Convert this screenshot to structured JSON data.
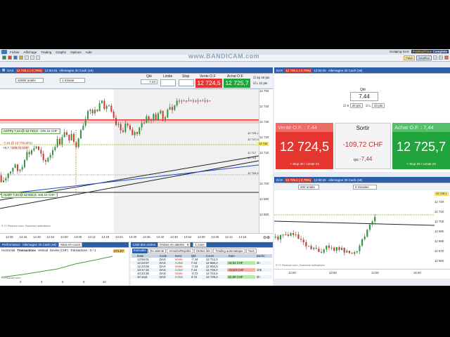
{
  "menu": {
    "items": [
      "Fichier",
      "Affichage",
      "Trading",
      "Graphs",
      "Options",
      "Aide"
    ]
  },
  "topright": {
    "platform_prefix": "Scalping DAX",
    "brand": "ProRealTime",
    "brand_suffix": "Complete",
    "paste": "Patch",
    "account": "DealRoo"
  },
  "watermark": "www.BANDICAM.com",
  "chart1": {
    "title_prefix": "DAX",
    "price": "12 725,1 (-2,79%)",
    "time": "12:50:45",
    "instrument": "Allemagne 30 Cash (1€)",
    "units_select": "10000 unités",
    "tf_select": "1 minute",
    "qty_label": "Qté",
    "qty_value": "7.44",
    "limit_label": "Limite",
    "stop_label": "Stop",
    "sell_label": "Vente O.F.",
    "buy_label": "Achat O.F.",
    "sell_price": "12 724,5",
    "buy_price": "12 725,7",
    "sp_label": "Sp",
    "sp_value": "20 pts",
    "l_label": "L",
    "l_value": "21 pts",
    "tag_stp": "ASTPy 7,44 @ 12 732,0",
    "tag_stp_val": "-109,16 CHF",
    "tag_pos": "-7,44 @ 12 732,8(%)",
    "tag_pos_val": "-109,72 CHF",
    "tag_pos_sub": "+0,7",
    "tag_lmt": "ALMT 7,44 @ 12 641,0",
    "tag_lmt_val": "165,10 CHF",
    "source": "© IT-Finance.com, Données indicatives",
    "yticks": [
      "12 750",
      "12 740",
      "12 730",
      "12 720",
      "12 710",
      "12 700",
      "12 690",
      "12 680"
    ],
    "ymarks": [
      "12 729,1",
      "12 727,0",
      "12 717",
      "12 713",
      "12 705,5",
      "12 703",
      "12 725"
    ],
    "xticks": [
      "12:36",
      "12:42",
      "12:48",
      "12:54",
      "13:00",
      "13:06",
      "13:12",
      "13:18",
      "13:24",
      "13:30",
      "13:36",
      "13:42",
      "13:48",
      "13:54",
      "14:00",
      "14:06",
      "14:12",
      "14:18"
    ]
  },
  "ticket": {
    "title_prefix": "DAX",
    "price": "12 725,1 (-2,79%)",
    "time": "12:50:45",
    "instrument": "Allemagne 30 Cash (1€)",
    "qty_label": "Qté",
    "qty_value": "7.44",
    "s_label": "S",
    "s_value": "20 pts",
    "l_label": "L",
    "l_value": "23 pts",
    "sell_head": "Vente O.F. : 7,44",
    "exit_head": "Sortir",
    "buy_head": "Achat O.F. : 7,44",
    "sell_price": "12 724,5",
    "pnl": "-109,72 CHF",
    "buy_price": "12 725,7",
    "sell_sub": "+ Stop 20 / Limite 23",
    "qty_sub_label": "Qté",
    "qty_sub": "-7,44",
    "buy_sub": "+ Stop 20 / Limite 23"
  },
  "chart2": {
    "title_prefix": "DAX",
    "price": "12 725,1 (-2,79%)",
    "time": "12:50:45",
    "instrument": "Allemagne 30 Cash (1€)",
    "units_select": "200 unités",
    "tf_select": "5 minutes",
    "source": "© IT-Finance.com, Données indicatives",
    "yticks": [
      "12 720",
      "12 710",
      "12 700",
      "12 690",
      "12 680",
      "12 670",
      "12 660"
    ],
    "xticks": [
      "12:00",
      "13:00",
      "14:00",
      "15:00"
    ],
    "mark": "12 725,1"
  },
  "perf": {
    "title": "Performance",
    "instrument": "Allemagne 30 Cash (1€)",
    "period": "Mois en cours",
    "tabs": [
      "Horizontal",
      "Transactions",
      "Vertical",
      "Devise (CHF)",
      "Transactions : 0 / 1"
    ],
    "value": "271,67",
    "source": "IT-Finance.com",
    "xticks": [
      "2",
      "4",
      "6",
      "8",
      "10"
    ]
  },
  "orders": {
    "title": "Liste des ordres",
    "filter": "Ordres en attente",
    "count": "8",
    "period": "1 mois",
    "tabs": [
      "Exécutés",
      "En attente",
      "Annulés/Rejetés",
      "Ordres liés",
      "Trading automatique",
      "Tous"
    ],
    "columns": [
      "",
      "Date",
      "Code",
      "Sens",
      "Qté",
      "Cours",
      "Gain",
      "Durée"
    ],
    "rows": [
      [
        "",
        "13:56:01",
        "DAX",
        "Vente",
        "-7.44",
        "12 712,0",
        "",
        ""
      ],
      [
        "",
        "12:23:57",
        "DAX",
        "Achat",
        "7.44",
        "12 665,2",
        "16,83 CHF",
        "4h"
      ],
      [
        "",
        "12:23:06",
        "DAX",
        "Vente",
        "-7.44",
        "12 653,5",
        "",
        ""
      ],
      [
        "",
        "10:17:32",
        "DAX",
        "Achat",
        "7.44",
        "12 720,2",
        "-22,83 CHF",
        "1h5"
      ],
      [
        "",
        "10:43:36",
        "DAX",
        "Vente",
        "-3.72",
        "12 744,5",
        "",
        ""
      ],
      [
        "",
        "10 sept.",
        "DAX",
        "Achat",
        "3.72",
        "12 728,2",
        "52,89 CHF",
        "2h"
      ]
    ]
  }
}
